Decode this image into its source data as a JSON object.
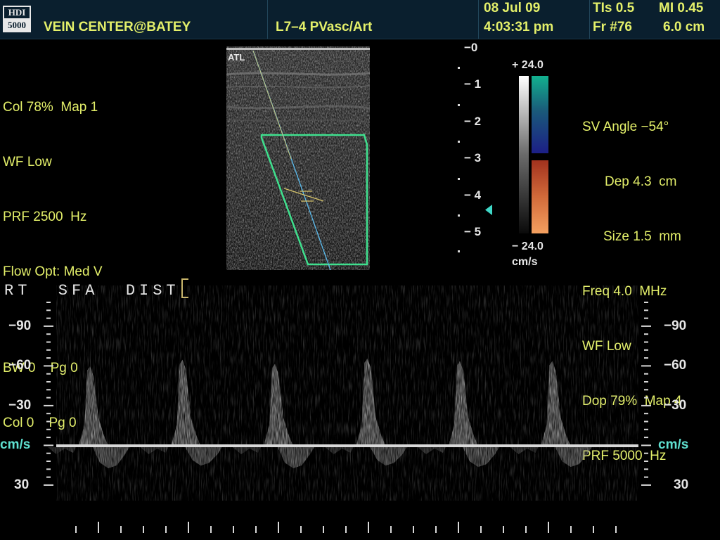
{
  "header": {
    "logo_top": "HDI",
    "logo_bottom": "5000",
    "facility": "VEIN CENTER@BATEY",
    "transducer_preset": "L7–4 PVasc/Art",
    "date": "08 Jul 09",
    "time": "4:03:31 pm",
    "tis": "TIs 0.5",
    "mi": "MI 0.45",
    "frame": "Fr #76",
    "depth": "6.0 cm"
  },
  "color_settings": {
    "line1": "Col 78%  Map 1",
    "line2": "WF Low",
    "line3": "PRF 2500  Hz",
    "line4": "Flow Opt: Med V",
    "line5": "BW 0    Pg 0",
    "line6": "Col 0    Pg 0"
  },
  "doppler_settings": {
    "sv_angle": "SV Angle −54°",
    "dep": "Dep 4.3  cm",
    "size": "Size 1.5  mm",
    "freq": "Freq 4.0  MHz",
    "wf": "WF Low",
    "dop": "Dop 79%  Map 4",
    "prf": "PRF 5000  Hz"
  },
  "bmode_image": {
    "label": "ATL"
  },
  "depth_scale": {
    "labels": [
      "−0",
      "− 1",
      "− 2",
      "− 3",
      "− 4",
      "− 5"
    ]
  },
  "color_bar": {
    "top_label": "+ 24.0",
    "bottom_label": "− 24.0",
    "unit": "cm/s",
    "colors": {
      "top": "#0d9a84",
      "mid_top": "#1c1f86",
      "mid_bottom": "#a2321e",
      "bottom": "#f4a060"
    }
  },
  "spectral": {
    "title": "RT  SFA  DIST",
    "left_labels": [
      "−90",
      "−60",
      "−30",
      "cm/s",
      "30"
    ],
    "right_labels": [
      "−90",
      "−60",
      "−30",
      "cm/s",
      "30"
    ],
    "baseline_color": "#d8d8d8",
    "peaks_cms": [
      -60,
      -65,
      -62,
      -66,
      -64,
      -64
    ],
    "reverse_cms": [
      17,
      15,
      17,
      15,
      16,
      16
    ]
  },
  "colors": {
    "text_yellow": "#e4f06a",
    "header_bg": "#0a1f2e",
    "cyan": "#5fe0d0"
  }
}
